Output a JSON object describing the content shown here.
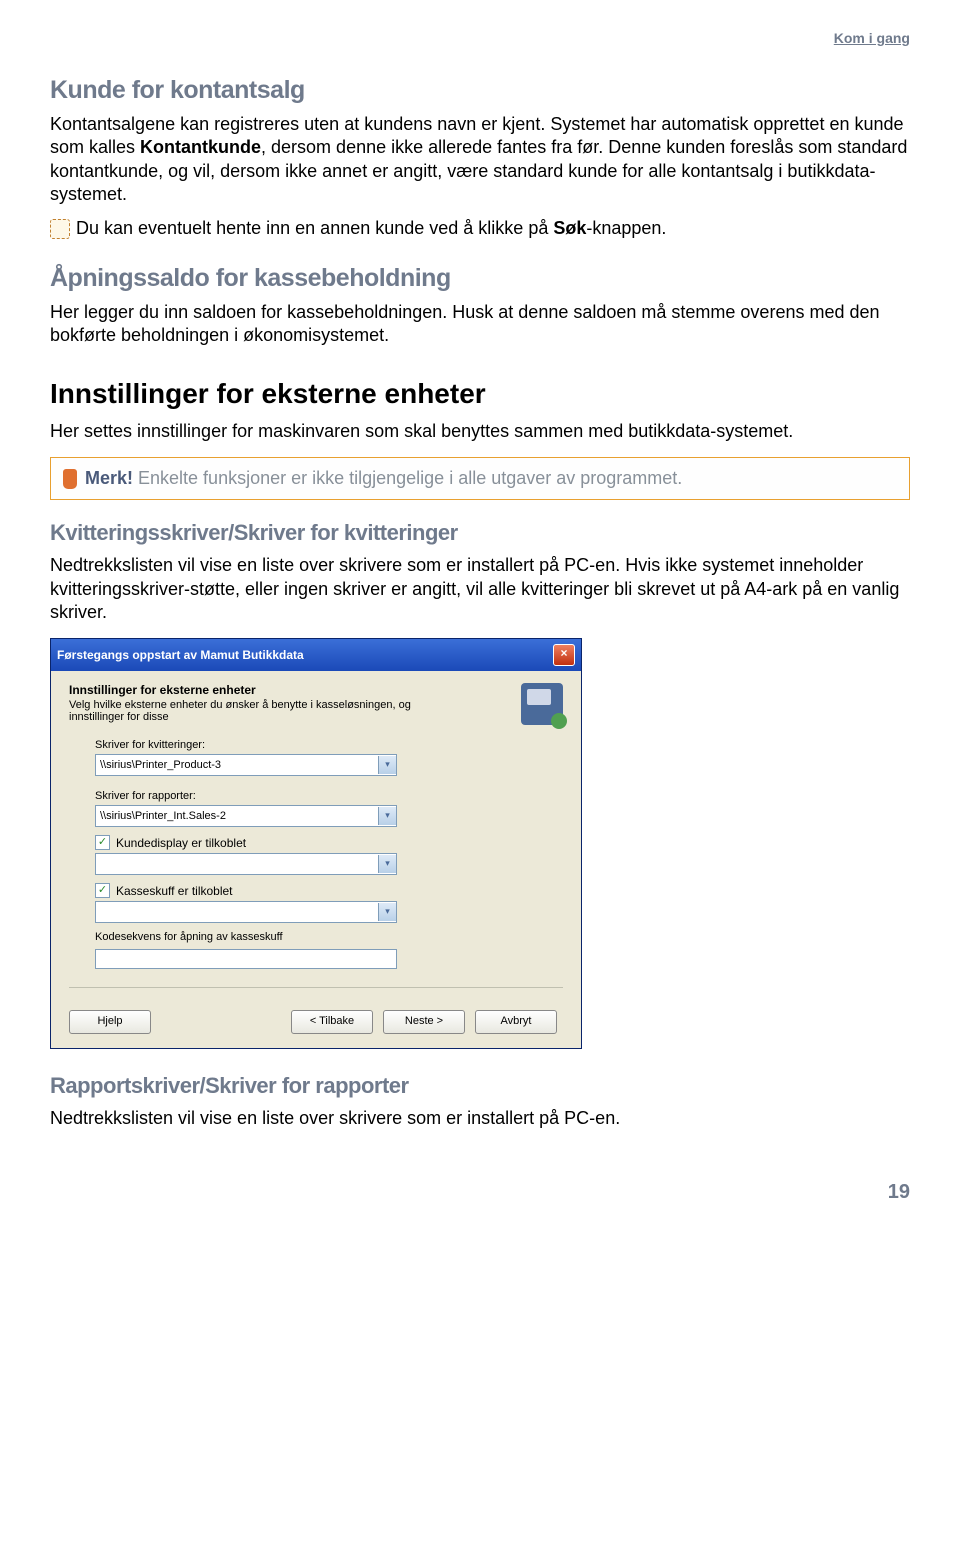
{
  "top_link": "Kom i gang",
  "s1": {
    "title": "Kunde for kontantsalg",
    "p1a": "Kontantsalgene kan registreres uten at kundens navn er kjent. Systemet har automatisk opprettet en kunde som kalles ",
    "p1b": "Kontantkunde",
    "p1c": ", dersom denne ikke allerede fantes fra før. Denne kunden foreslås som standard kontantkunde, og vil, dersom ikke annet er angitt, være standard kunde for alle kontantsalg i butikkdata-systemet.",
    "tip_a": "Du kan eventuelt hente inn en annen kunde ved å klikke på ",
    "tip_b": "Søk",
    "tip_c": "-knappen."
  },
  "s2": {
    "title": "Åpningssaldo for kassebeholdning",
    "p1": "Her legger du inn saldoen for kassebeholdningen. Husk at denne saldoen må stemme overens med den bokførte beholdningen i økonomisystemet."
  },
  "s3": {
    "title": "Innstillinger for eksterne enheter",
    "p1": "Her settes innstillinger for maskinvaren som skal benyttes sammen med butikkdata-systemet."
  },
  "note": {
    "merk": "Merk!",
    "text": " Enkelte funksjoner er ikke tilgjengelige i alle utgaver av programmet."
  },
  "s4": {
    "title": "Kvitteringsskriver/Skriver for kvitteringer",
    "p1": "Nedtrekkslisten vil vise en liste over skrivere som er installert på PC-en. Hvis ikke systemet inneholder kvitteringsskriver-støtte, eller ingen skriver er angitt, vil alle kvitteringer bli skrevet ut på A4-ark på en vanlig skriver."
  },
  "dialog": {
    "title": "Førstegangs oppstart av Mamut Butikkdata",
    "header_title": "Innstillinger for eksterne enheter",
    "header_desc": "Velg hvilke eksterne enheter du ønsker å benytte i kasseløsningen, og innstillinger for disse",
    "f1_label": "Skriver for kvitteringer:",
    "f1_value": "\\\\sirius\\Printer_Product-3",
    "f2_label": "Skriver for rapporter:",
    "f2_value": "\\\\sirius\\Printer_Int.Sales-2",
    "chk1": "Kundedisplay er tilkoblet",
    "chk2": "Kasseskuff er tilkoblet",
    "f3_label": "Kodesekvens for åpning av kasseskuff",
    "btn_help": "Hjelp",
    "btn_back": "< Tilbake",
    "btn_next": "Neste >",
    "btn_cancel": "Avbryt"
  },
  "s5": {
    "title": "Rapportskriver/Skriver for rapporter",
    "p1": "Nedtrekkslisten vil vise en liste over skrivere som er installert på PC-en."
  },
  "page_num": "19"
}
